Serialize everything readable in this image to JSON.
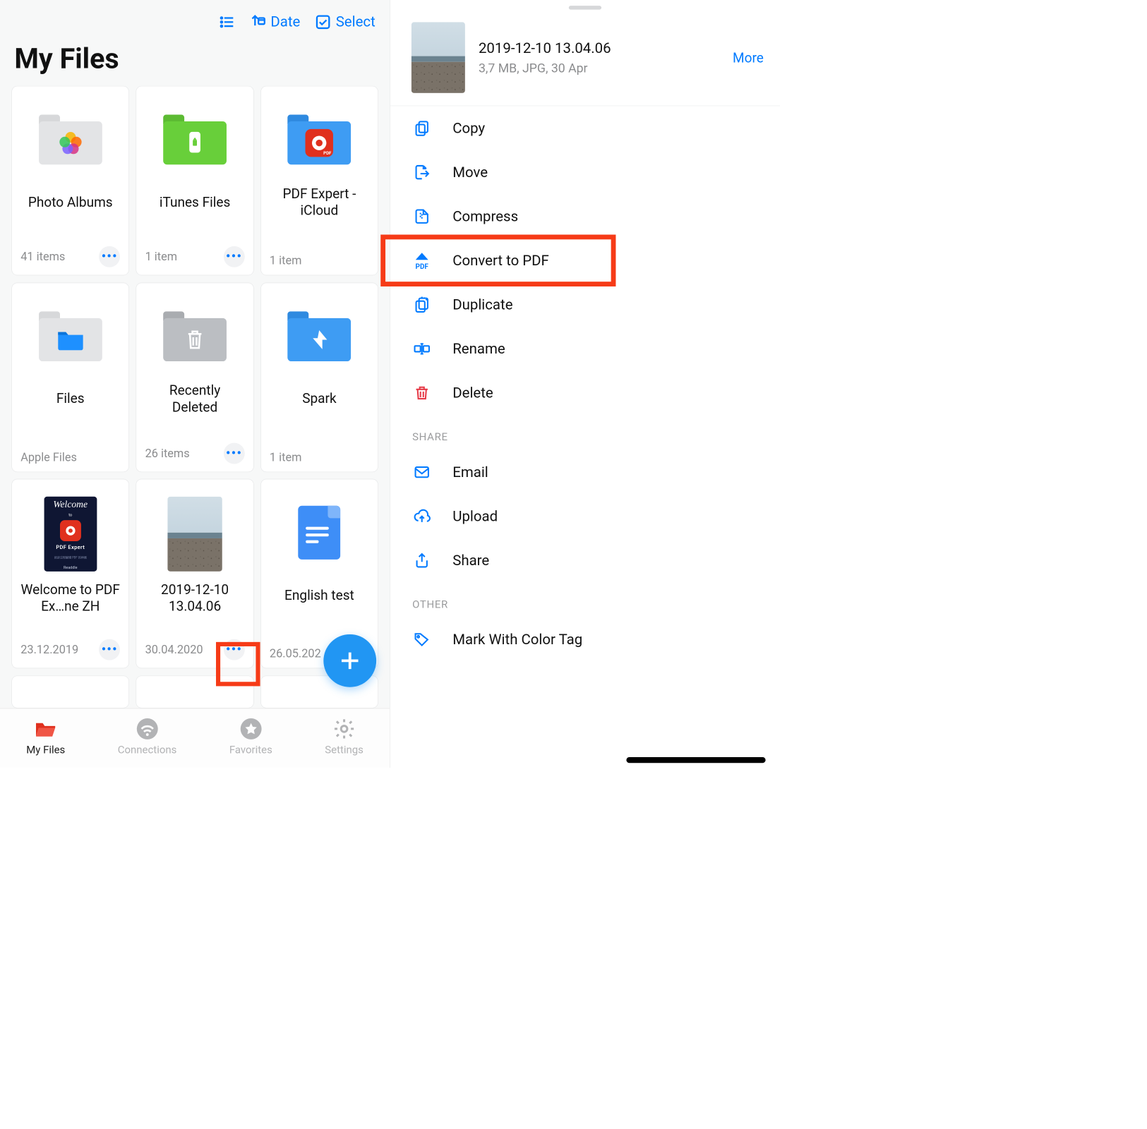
{
  "toolbar": {
    "date_label": "Date",
    "select_label": "Select"
  },
  "page_title": "My Files",
  "tiles": [
    {
      "name": "Photo Albums",
      "meta": "41 items"
    },
    {
      "name": "iTunes Files",
      "meta": "1 item"
    },
    {
      "name": "PDF Expert - iCloud",
      "meta": "1 item"
    },
    {
      "name": "Files",
      "meta": "Apple Files"
    },
    {
      "name": "Recently Deleted",
      "meta": "26 items"
    },
    {
      "name": "Spark",
      "meta": "1 item"
    },
    {
      "name": "Welcome to PDF Ex…ne ZH",
      "meta": "23.12.2019"
    },
    {
      "name": "2019-12-10 13.04.06",
      "meta": "30.04.2020"
    },
    {
      "name": "English test",
      "meta": "26.05.202"
    }
  ],
  "tabs": [
    {
      "label": "My Files"
    },
    {
      "label": "Connections"
    },
    {
      "label": "Favorites"
    },
    {
      "label": "Settings"
    }
  ],
  "detail": {
    "filename": "2019-12-10 13.04.06",
    "meta": "3,7 MB, JPG, 30 Apr",
    "more": "More"
  },
  "actions": {
    "copy": "Copy",
    "move": "Move",
    "compress": "Compress",
    "convert": "Convert to PDF",
    "duplicate": "Duplicate",
    "rename": "Rename",
    "delete": "Delete"
  },
  "share_header": "SHARE",
  "share_actions": {
    "email": "Email",
    "upload": "Upload",
    "share": "Share"
  },
  "other_header": "OTHER",
  "other_actions": {
    "color_tag": "Mark With Color Tag"
  },
  "colors": {
    "accent": "#007aff",
    "danger": "#e63946",
    "highlight": "#f63b17"
  }
}
